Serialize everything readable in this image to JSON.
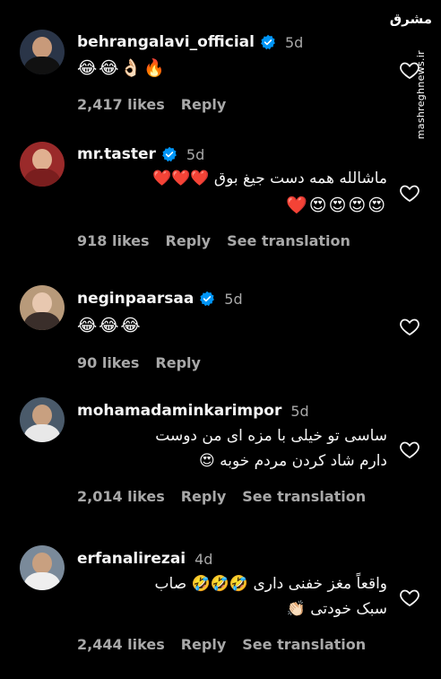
{
  "watermark": {
    "logo": "مشرق",
    "site": "mashreghnews.ir"
  },
  "comments": [
    {
      "username": "behrangalavi_official",
      "verified": true,
      "time": "5d",
      "lines": [
        "😂😂👌🏻🔥"
      ],
      "likes": "2,417 likes",
      "reply": "Reply",
      "translate": ""
    },
    {
      "username": "mr.taster",
      "verified": true,
      "time": "5d",
      "lines": [
        "ماشالله همه دست جیغ بوق ❤️❤️❤️",
        "😍😍😍😍❤️"
      ],
      "likes": "918 likes",
      "reply": "Reply",
      "translate": "See translation"
    },
    {
      "username": "neginpaarsaa",
      "verified": true,
      "time": "5d",
      "lines": [
        "😂😂😂"
      ],
      "likes": "90 likes",
      "reply": "Reply",
      "translate": ""
    },
    {
      "username": "mohamadaminkarimpor",
      "verified": false,
      "time": "5d",
      "lines": [
        "ساسی تو خیلی با مزه ای من دوست",
        "دارم شاد کردن مردم خوبه 😍"
      ],
      "likes": "2,014 likes",
      "reply": "Reply",
      "translate": "See translation"
    },
    {
      "username": "erfanalirezai",
      "verified": false,
      "time": "4d",
      "lines": [
        "واقعاً مغز خفنی داری 🤣🤣🤣 صاب",
        "سبک خودتی 👏🏻"
      ],
      "likes": "2,444 likes",
      "reply": "Reply",
      "translate": "See translation"
    }
  ]
}
